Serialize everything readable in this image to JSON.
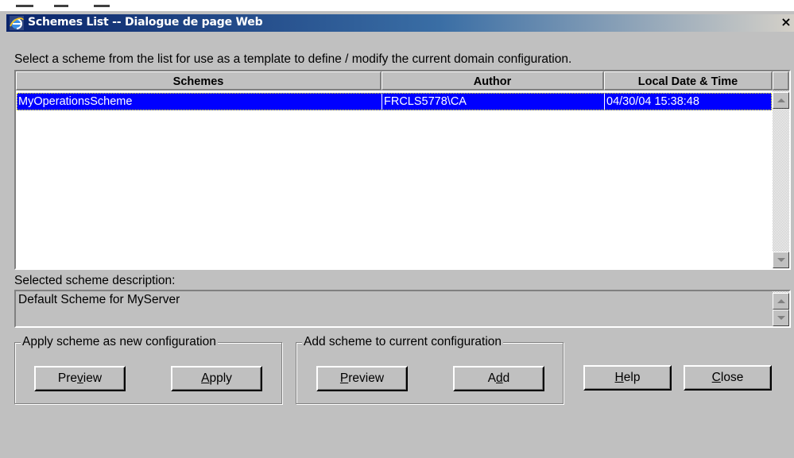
{
  "window": {
    "title": "Schemes List -- Dialogue de page Web",
    "close_glyph": "×"
  },
  "instruction": "Select a scheme from the list for use as a template to define / modify the current domain configuration.",
  "table": {
    "columns": [
      "Schemes",
      "Author",
      "Local Date & Time"
    ],
    "rows": [
      {
        "scheme": "MyOperationsScheme",
        "author": "FRCLS5778\\CA",
        "datetime": "04/30/04 15:38:48"
      }
    ]
  },
  "description": {
    "label": "Selected scheme description:",
    "value": "Default Scheme for MyServer"
  },
  "groups": {
    "apply": {
      "legend": "Apply scheme as new configuration",
      "preview": {
        "pre": "Pre",
        "accel": "v",
        "post": "iew"
      },
      "apply": {
        "pre": "",
        "accel": "A",
        "post": "pply"
      }
    },
    "add": {
      "legend": "Add scheme to current configuration",
      "preview": {
        "pre": "",
        "accel": "P",
        "post": "review"
      },
      "add": {
        "pre": "A",
        "accel": "d",
        "post": "d"
      }
    }
  },
  "buttons": {
    "help": {
      "pre": "",
      "accel": "H",
      "post": "elp"
    },
    "close": {
      "pre": "",
      "accel": "C",
      "post": "lose"
    }
  },
  "colors": {
    "dialog_bg": "#c0c0c0",
    "selection": "#0000ff",
    "titlebar_start": "#0a246a"
  }
}
